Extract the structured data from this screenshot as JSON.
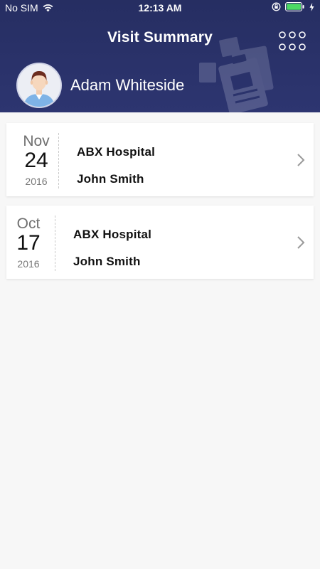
{
  "status_bar": {
    "carrier": "No SIM",
    "time": "12:13 AM"
  },
  "header": {
    "title": "Visit Summary",
    "user_name": "Adam Whiteside"
  },
  "visits": [
    {
      "month": "Nov",
      "day": "24",
      "year": "2016",
      "hospital": "ABX Hospital",
      "doctor": "John Smith"
    },
    {
      "month": "Oct",
      "day": "17",
      "year": "2016",
      "hospital": "ABX Hospital",
      "doctor": "John Smith"
    }
  ],
  "colors": {
    "header_bg": "#2a3268",
    "background": "#f7f7f7",
    "card": "#ffffff",
    "battery": "#4cd964"
  },
  "icons": [
    "wifi-icon",
    "orientation-lock-icon",
    "battery-icon",
    "charging-icon",
    "menu-grid-icon",
    "chevron-right-icon",
    "avatar-icon"
  ]
}
